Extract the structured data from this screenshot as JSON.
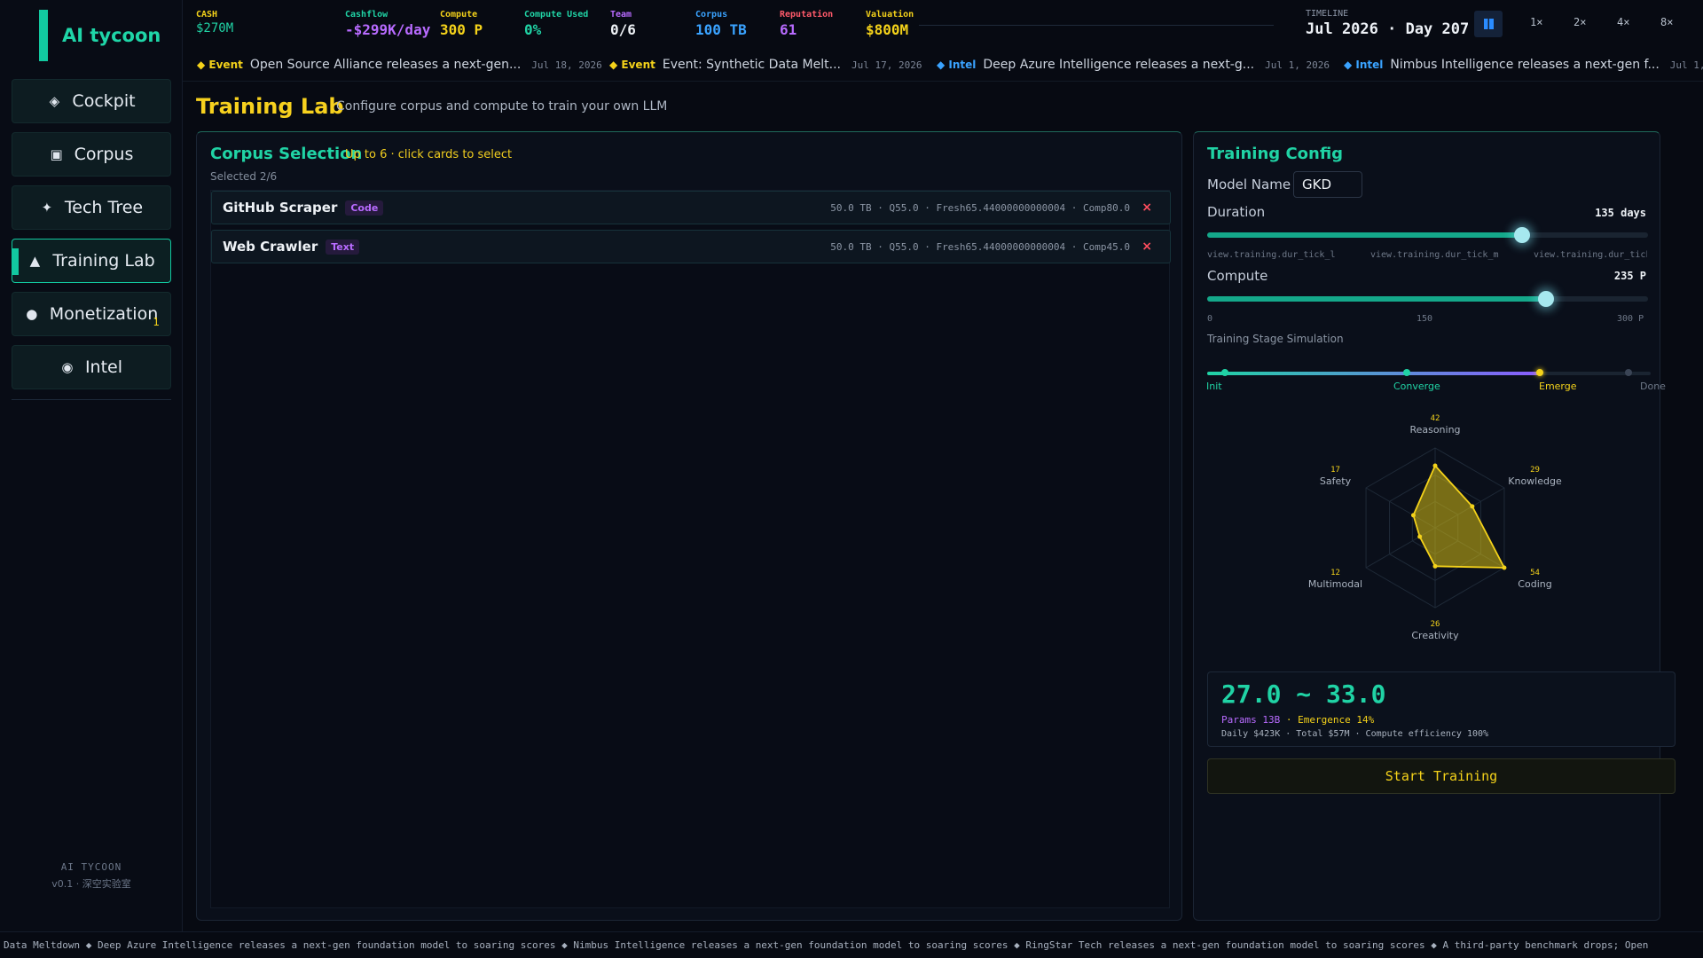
{
  "app": {
    "logo": "AI tycoon"
  },
  "sidebar": {
    "items": [
      {
        "icon": "◈",
        "label": "Cockpit",
        "badge": ""
      },
      {
        "icon": "▣",
        "label": "Corpus",
        "badge": ""
      },
      {
        "icon": "✦",
        "label": "Tech Tree",
        "badge": ""
      },
      {
        "icon": "▲",
        "label": "Training Lab",
        "badge": "",
        "active": true
      },
      {
        "icon": "●",
        "label": "Monetization",
        "badge": "1"
      },
      {
        "icon": "◉",
        "label": "Intel",
        "badge": ""
      }
    ],
    "footer_line1": "AI TYCOON",
    "footer_line2": "v0.1 · 深空实验室"
  },
  "topbar": {
    "stats": [
      {
        "label": "CASH",
        "value": "$270M",
        "label_color": "#f4d21a",
        "value_color": "#20d3a5"
      },
      {
        "label": "Cashflow",
        "value": "-$299K/day",
        "label_color": "#20d3a5",
        "value_color": "#b86bff"
      },
      {
        "label": "Compute",
        "value": "300 P",
        "label_color": "#f4d21a",
        "value_color": "#f4d21a"
      },
      {
        "label": "Compute Used",
        "value": "0%",
        "label_color": "#20d3a5",
        "value_color": "#20d3a5"
      },
      {
        "label": "Team",
        "value": "0/6",
        "label_color": "#b86bff",
        "value_color": "#eef2f6"
      },
      {
        "label": "Corpus",
        "value": "100 TB",
        "label_color": "#3aa3ff",
        "value_color": "#3aa3ff"
      },
      {
        "label": "Reputation",
        "value": "61",
        "label_color": "#ff5a6a",
        "value_color": "#b86bff"
      },
      {
        "label": "Valuation",
        "value": "$800M",
        "label_color": "#f4d21a",
        "value_color": "#f4d21a"
      }
    ],
    "timeline_label": "TIMELINE",
    "timeline_value": "Jul 2026 · Day 207",
    "speeds": [
      "1×",
      "2×",
      "4×",
      "8×"
    ]
  },
  "ticker": [
    {
      "kind": "Event",
      "kind_color": "#f4d21a",
      "message": "Open Source Alliance releases a next-gen...",
      "date": "Jul 18, 2026"
    },
    {
      "kind": "Event",
      "kind_color": "#f4d21a",
      "message": "Event: Synthetic Data Melt...",
      "date": "Jul 17, 2026"
    },
    {
      "kind": "Intel",
      "kind_color": "#3aa3ff",
      "message": "Deep Azure Intelligence releases a next-g...",
      "date": "Jul 1, 2026"
    },
    {
      "kind": "Intel",
      "kind_color": "#3aa3ff",
      "message": "Nimbus Intelligence releases a next-gen f...",
      "date": "Jul 1,"
    }
  ],
  "page": {
    "title": "Training Lab",
    "subtitle": "Configure corpus and compute to train your own LLM"
  },
  "corpus": {
    "title": "Corpus Selection",
    "hint": "Up to 6 · click cards to select",
    "selected": "Selected 2/6",
    "items": [
      {
        "name": "GitHub Scraper",
        "tag": "Code",
        "meta": "50.0 TB · Q55.0 · Fresh65.44000000000004 · Comp80.0"
      },
      {
        "name": "Web Crawler",
        "tag": "Text",
        "meta": "50.0 TB · Q55.0 · Fresh65.44000000000004 · Comp45.0"
      }
    ],
    "remove_glyph": "×"
  },
  "config": {
    "title": "Training Config",
    "model_label": "Model Name",
    "model_value": "GKD",
    "duration_label": "Duration",
    "duration_value": "135 days",
    "duration_fraction": 0.715,
    "duration_ticks": [
      "view.training.dur_tick_l",
      "view.training.dur_tick_m",
      "view.training.dur_tick_r"
    ],
    "compute_label": "Compute",
    "compute_value": "235 P",
    "compute_fraction": 0.768,
    "compute_ticks": [
      "0",
      "150",
      "300 P"
    ],
    "stage_title": "Training Stage Simulation",
    "stages": [
      {
        "label": "Init",
        "color": "#20d3a5"
      },
      {
        "label": "Converge",
        "color": "#20d3a5"
      },
      {
        "label": "Emerge",
        "color": "#f4d21a"
      },
      {
        "label": "Done",
        "color": "#6f7989"
      }
    ],
    "stage_progress": 0.75,
    "radar": [
      {
        "axis": "Reasoning",
        "value": 42
      },
      {
        "axis": "Knowledge",
        "value": 29
      },
      {
        "axis": "Coding",
        "value": 54
      },
      {
        "axis": "Creativity",
        "value": 26
      },
      {
        "axis": "Multimodal",
        "value": 12
      },
      {
        "axis": "Safety",
        "value": 17
      }
    ],
    "radar_max": 54,
    "result_range": "27.0 ~ 33.0",
    "result_params": "Params 13B",
    "result_emergence": "· Emergence 14%",
    "result_detail": "Daily $423K · Total $57M · Compute efficiency 100%",
    "start_label": "Start Training",
    "colors": {
      "accent": "#20d3a5",
      "highlight": "#f4d21a",
      "purple": "#b86bff"
    }
  },
  "bottom_ticker": "Data Meltdown  ◆  Deep Azure Intelligence releases a next-gen foundation model to soaring scores  ◆  Nimbus Intelligence releases a next-gen foundation model to soaring scores  ◆  RingStar Tech releases a next-gen foundation model to soaring scores  ◆  A third-party benchmark drops; Open"
}
